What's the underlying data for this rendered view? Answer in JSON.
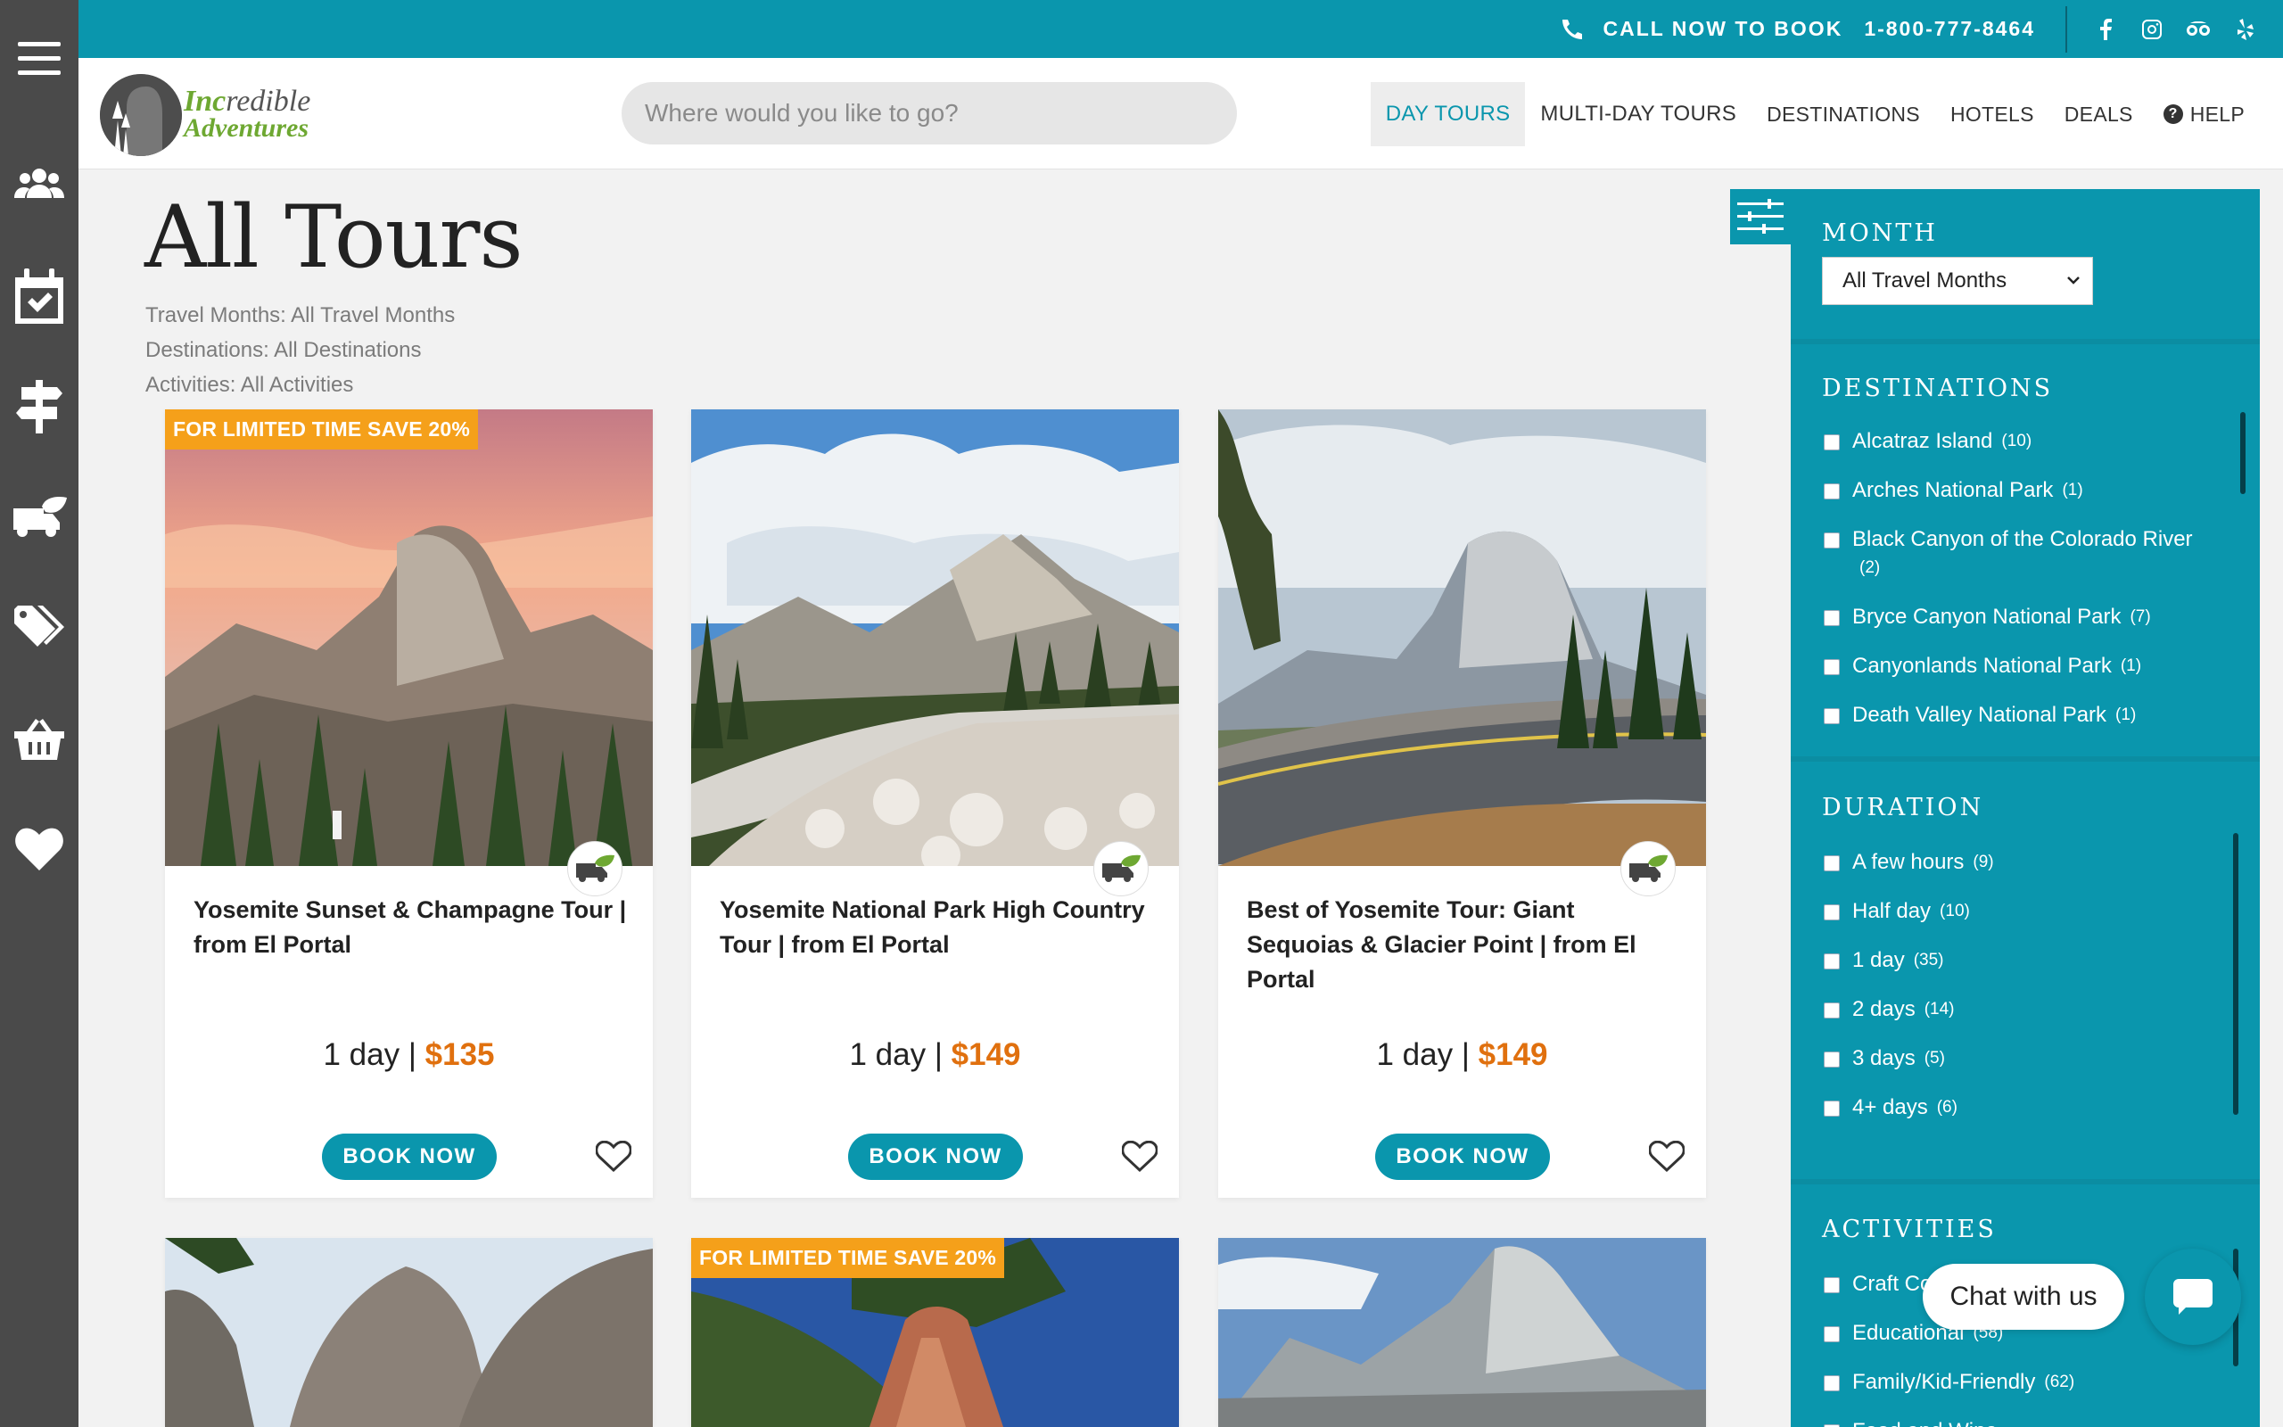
{
  "topbar": {
    "call_label": "CALL NOW TO BOOK",
    "phone": "1-800-777-8464",
    "social_icons": [
      "facebook-icon",
      "instagram-icon",
      "tripadvisor-icon",
      "yelp-icon"
    ]
  },
  "logo": {
    "part1": "Inc",
    "part2": "redible",
    "line2": "Adventures"
  },
  "search": {
    "placeholder": "Where would you like to go?"
  },
  "nav": {
    "items": [
      {
        "label": "DAY TOURS",
        "active": true
      },
      {
        "label": "MULTI-DAY TOURS"
      },
      {
        "label": "DESTINATIONS"
      },
      {
        "label": "HOTELS"
      },
      {
        "label": "DEALS"
      },
      {
        "label": "HELP"
      }
    ]
  },
  "rail": {
    "icons": [
      "menu-icon",
      "group-icon",
      "calendar-check-icon",
      "signpost-icon",
      "eco-bus-icon",
      "tags-icon",
      "basket-icon",
      "heart-icon"
    ]
  },
  "page": {
    "title": "All Tours",
    "summary": [
      "Travel Months: All Travel Months",
      "Destinations: All Destinations",
      "Activities: All Activities"
    ]
  },
  "tours": [
    {
      "badge": "FOR LIMITED TIME SAVE 20%",
      "title": "Yosemite Sunset & Champagne Tour | from El Portal",
      "duration": "1 day | ",
      "price": "$135",
      "cta": "BOOK NOW"
    },
    {
      "badge": "",
      "title": "Yosemite National Park High Country Tour | from El Portal",
      "duration": "1 day | ",
      "price": "$149",
      "cta": "BOOK NOW"
    },
    {
      "badge": "",
      "title": "Best of Yosemite Tour: Giant Sequoias & Glacier Point | from El Portal",
      "duration": "1 day | ",
      "price": "$149",
      "cta": "BOOK NOW"
    },
    {
      "badge": ""
    },
    {
      "badge": "FOR LIMITED TIME SAVE 20%"
    },
    {
      "badge": ""
    }
  ],
  "filters": {
    "month": {
      "heading": "MONTH",
      "selected": "All Travel Months"
    },
    "destinations": {
      "heading": "DESTINATIONS",
      "items": [
        {
          "label": "Alcatraz Island",
          "count": "(10)"
        },
        {
          "label": "Arches National Park",
          "count": "(1)"
        },
        {
          "label": "Black Canyon of the Colorado River",
          "count": "(2)"
        },
        {
          "label": "Bryce Canyon National Park",
          "count": "(7)"
        },
        {
          "label": "Canyonlands National Park",
          "count": "(1)"
        },
        {
          "label": "Death Valley National Park",
          "count": "(1)"
        }
      ]
    },
    "duration": {
      "heading": "DURATION",
      "items": [
        {
          "label": "A few hours",
          "count": "(9)"
        },
        {
          "label": "Half day",
          "count": "(10)"
        },
        {
          "label": "1 day",
          "count": "(35)"
        },
        {
          "label": "2 days",
          "count": "(14)"
        },
        {
          "label": "3 days",
          "count": "(5)"
        },
        {
          "label": "4+ days",
          "count": "(6)"
        }
      ]
    },
    "activities": {
      "heading": "ACTIVITIES",
      "items": [
        {
          "label": "Craft Cocktails",
          "count": ""
        },
        {
          "label": "Educational",
          "count": "(58)"
        },
        {
          "label": "Family/Kid-Friendly",
          "count": "(62)"
        },
        {
          "label": "Food and Wine",
          "count": ""
        }
      ]
    }
  },
  "chat": {
    "label": "Chat with us"
  },
  "colors": {
    "teal": "#0a96ad",
    "orange": "#e0700e",
    "badge": "#f5a01a",
    "rail": "#4a4a4a"
  }
}
